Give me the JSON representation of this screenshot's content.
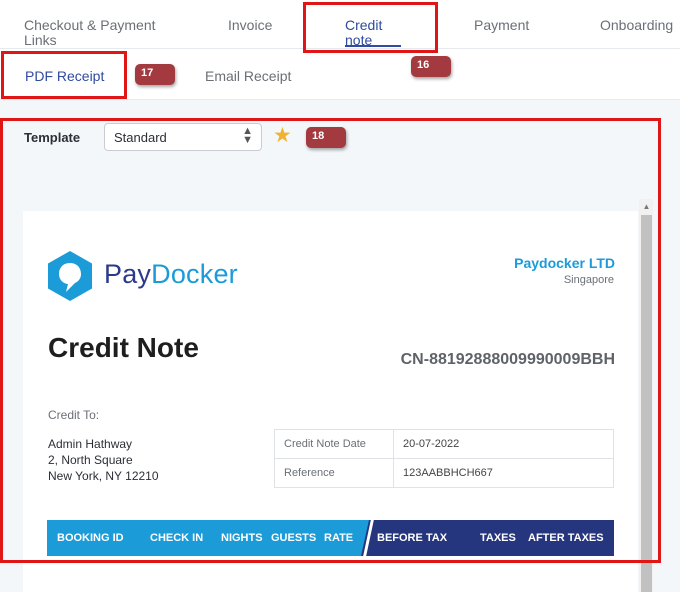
{
  "tabs": [
    {
      "label": "Checkout & Payment Links",
      "line1": "Checkout & Payment",
      "line2": "Links",
      "active": false
    },
    {
      "label": "Invoice",
      "active": false
    },
    {
      "label": "Credit note",
      "line1": "Credit",
      "line2": "note",
      "active": true
    },
    {
      "label": "Payment",
      "active": false
    },
    {
      "label": "Onboarding",
      "active": false
    }
  ],
  "subtabs": [
    {
      "label": "PDF Receipt",
      "active": true
    },
    {
      "label": "Email Receipt",
      "active": false
    }
  ],
  "badges": {
    "b16": "16",
    "b17": "17",
    "b18": "18"
  },
  "template": {
    "label": "Template",
    "selected": "Standard"
  },
  "document": {
    "logo": {
      "part1": "Pay",
      "part2": "Docker"
    },
    "company_name": "Paydocker LTD",
    "company_city": "Singapore",
    "title": "Credit Note",
    "number": "CN-88192888009990009BBH",
    "credit_to_label": "Credit To:",
    "address": [
      "Admin Hathway",
      "2, North Square",
      "New York, NY 12210"
    ],
    "info": [
      {
        "key": "Credit Note Date",
        "value": "20-07-2022"
      },
      {
        "key": "Reference",
        "value": "123AABBHCH667"
      }
    ],
    "columns": [
      "BOOKING ID",
      "CHECK IN",
      "NIGHTS",
      "GUESTS",
      "RATE",
      "BEFORE TAX",
      "TAXES",
      "AFTER TAXES"
    ]
  },
  "colors": {
    "accent": "#1b9bd7",
    "navy": "#25367f",
    "highlight": "#e01616",
    "badge": "#a23a3f",
    "star": "#f2b230"
  }
}
